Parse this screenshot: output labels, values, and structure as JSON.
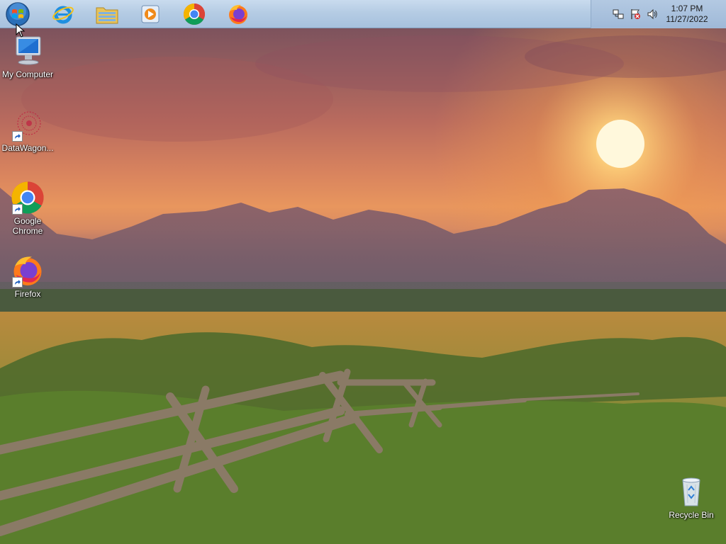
{
  "taskbar": {
    "start": {
      "icon": "windows-logo-icon"
    },
    "pinned": [
      {
        "name": "internet-explorer",
        "icon": "internet-explorer-icon"
      },
      {
        "name": "file-explorer",
        "icon": "folder-icon"
      },
      {
        "name": "media-player",
        "icon": "media-player-icon"
      },
      {
        "name": "google-chrome",
        "icon": "chrome-icon"
      },
      {
        "name": "firefox",
        "icon": "firefox-icon"
      }
    ],
    "tray": {
      "icons": [
        "network-icon",
        "action-center-flag-icon",
        "volume-icon"
      ],
      "time": "1:07 PM",
      "date": "11/27/2022"
    }
  },
  "desktop": {
    "icons": [
      {
        "label": "My Computer",
        "icon": "computer-icon",
        "shortcut": false
      },
      {
        "label": "DataWagon...",
        "icon": "datawagon-icon",
        "shortcut": true
      },
      {
        "label": "Google\nChrome",
        "icon": "chrome-icon",
        "shortcut": true
      },
      {
        "label": "Firefox",
        "icon": "firefox-icon",
        "shortcut": true
      },
      {
        "label": "Recycle Bin",
        "icon": "recycle-bin-icon",
        "shortcut": false
      }
    ]
  },
  "colors": {
    "taskbar": "#b5cce4",
    "chrome_red": "#db4437",
    "chrome_green": "#0f9d58",
    "chrome_yellow": "#f4b400",
    "chrome_blue": "#4285f4"
  }
}
